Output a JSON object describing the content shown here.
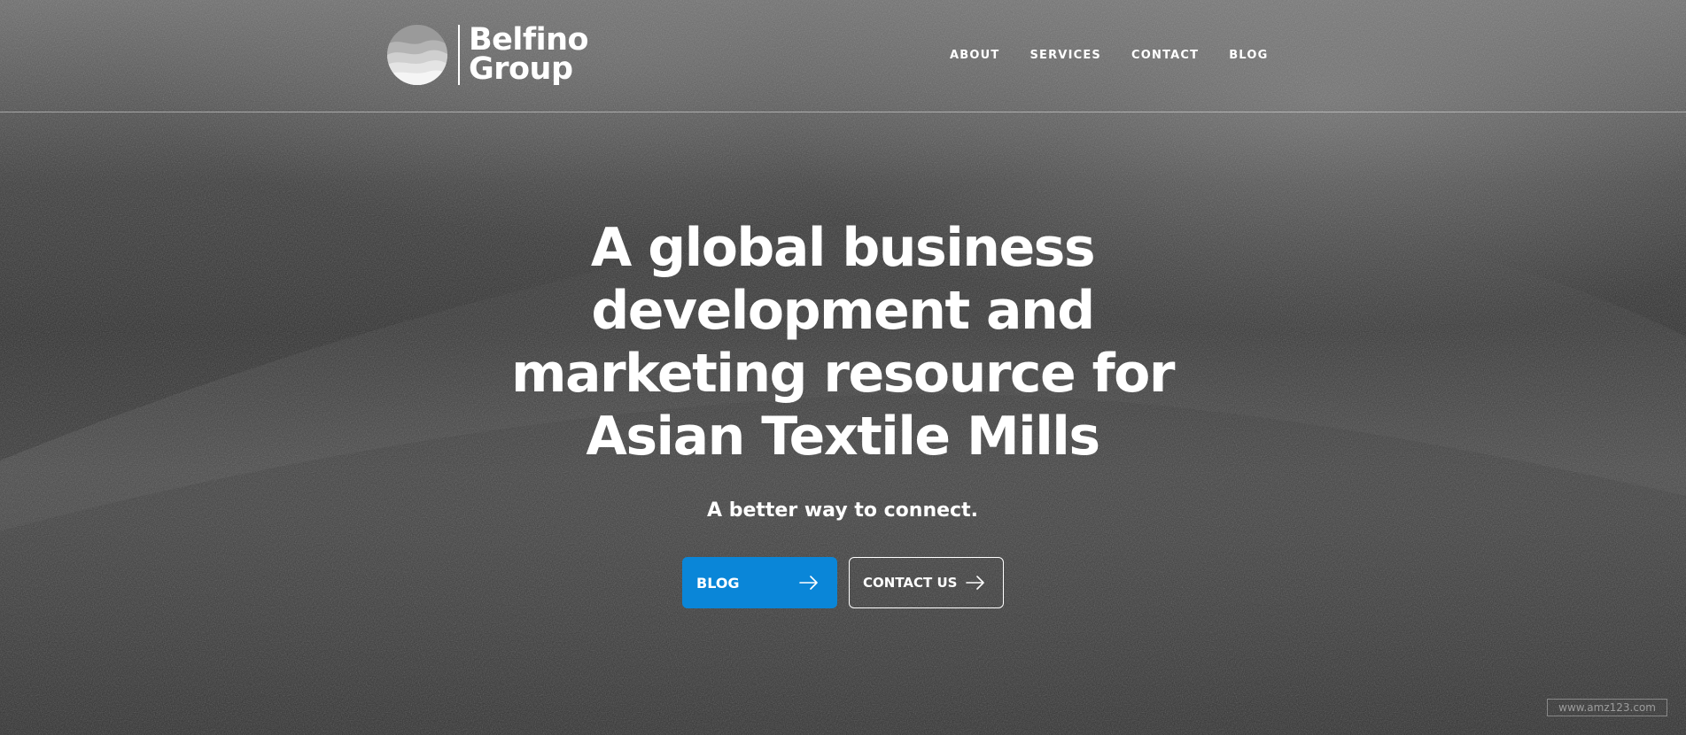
{
  "brand": {
    "name_line1": "Belfino",
    "name_line2": "Group"
  },
  "nav": {
    "items": [
      "ABOUT",
      "SERVICES",
      "CONTACT",
      "BLOG"
    ]
  },
  "hero": {
    "headline_lines": [
      "A global business",
      "development and",
      "marketing resource for",
      "Asian Textile Mills"
    ],
    "tagline": "A better way to connect.",
    "primary_button": "BLOG",
    "secondary_button": "CONTACT US"
  },
  "watermark": "www.amz123.com",
  "colors": {
    "accent": "#0a86d8",
    "text": "#ffffff"
  },
  "icons": {
    "logo": "layered-waves-circle-logo",
    "button_arrow": "arrow-right-icon"
  }
}
